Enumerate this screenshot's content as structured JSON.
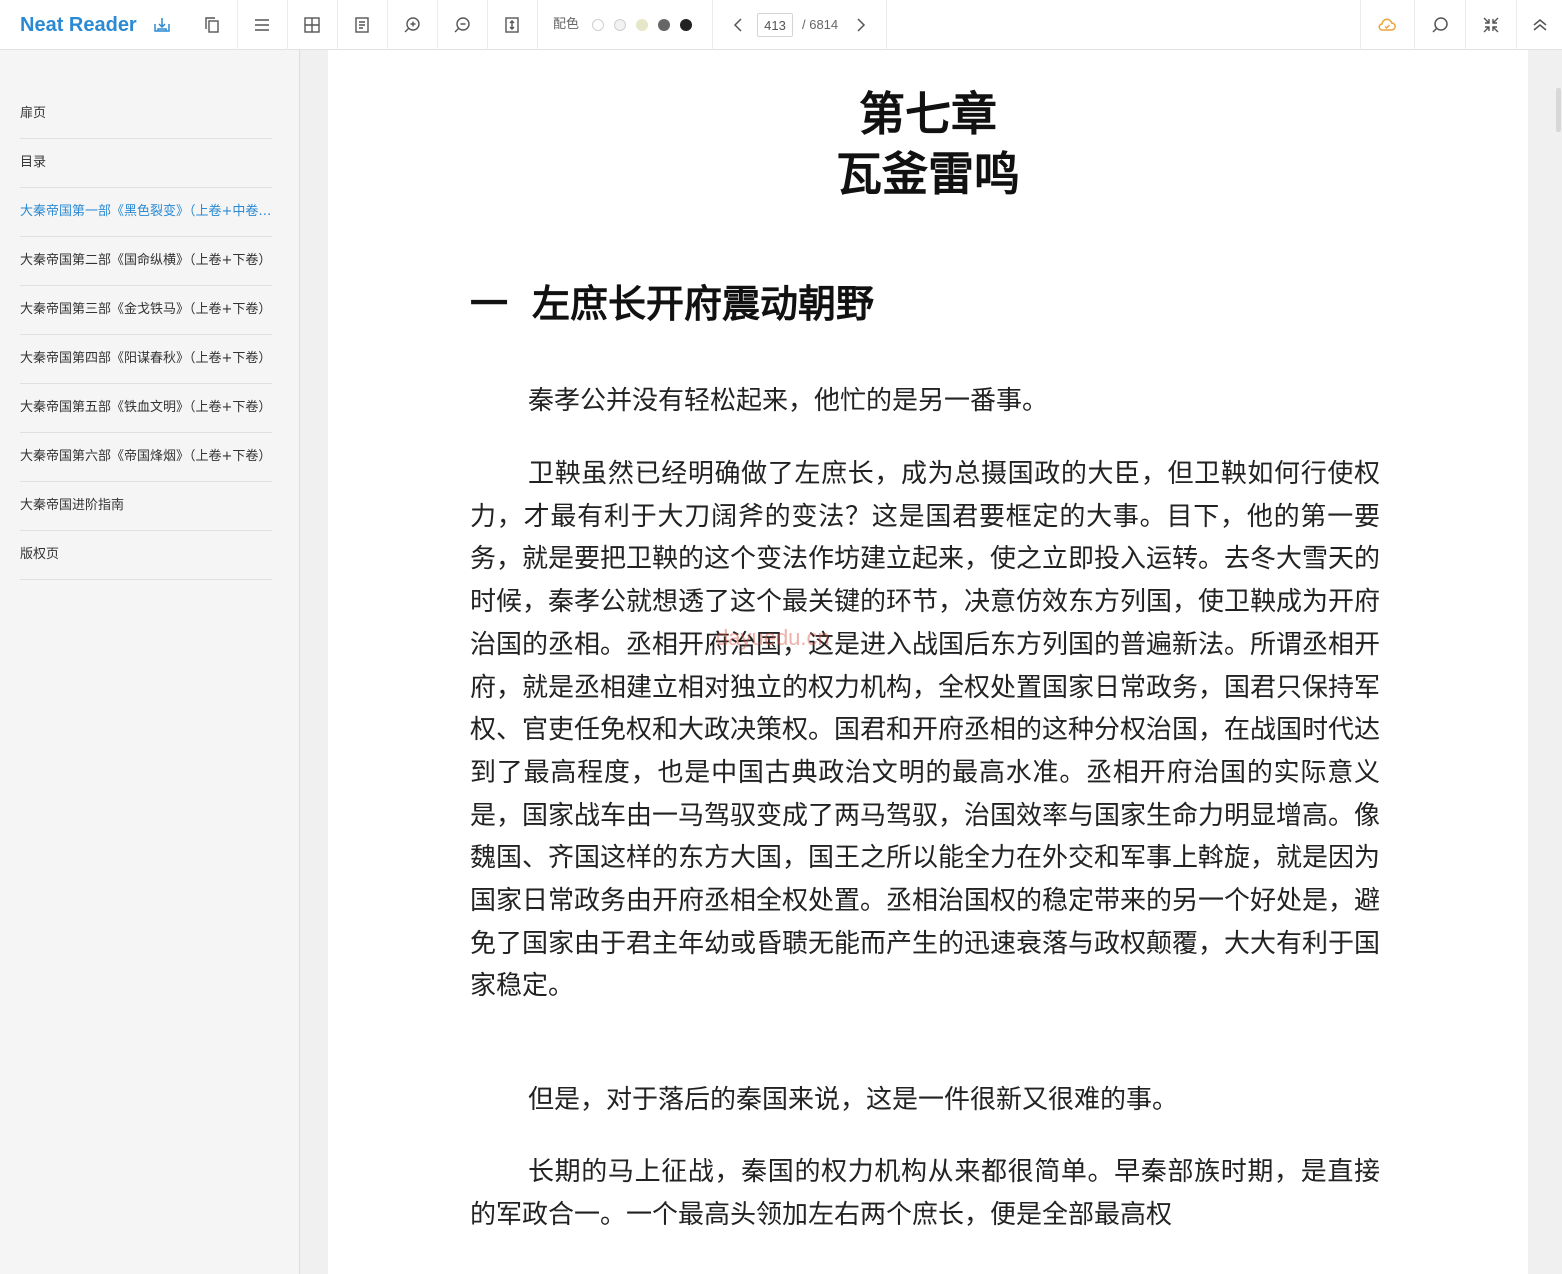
{
  "app": {
    "title": "Neat Reader"
  },
  "toolbar": {
    "theme_label": "配色",
    "theme_colors": [
      "#ffffff",
      "#f2f2f2",
      "#e6e6c8",
      "#666666",
      "#222222"
    ],
    "current_page": "413",
    "total_pages": "/ 6814"
  },
  "sidebar": {
    "items": [
      {
        "label": "扉页"
      },
      {
        "label": "目录"
      },
      {
        "label": "大秦帝国第一部《黑色裂变》（上卷+中卷+下卷）"
      },
      {
        "label": "大秦帝国第二部《国命纵横》（上卷+下卷）"
      },
      {
        "label": "大秦帝国第三部《金戈铁马》（上卷+下卷）"
      },
      {
        "label": "大秦帝国第四部《阳谋春秋》（上卷+下卷）"
      },
      {
        "label": "大秦帝国第五部《铁血文明》（上卷+下卷）"
      },
      {
        "label": "大秦帝国第六部《帝国烽烟》（上卷+下卷）"
      },
      {
        "label": "大秦帝国进阶指南"
      },
      {
        "label": "版权页"
      }
    ],
    "active_index": 2,
    "accent_color": "#2b8ad3"
  },
  "content": {
    "chapter_number": "第七章",
    "chapter_title": "瓦釜雷鸣",
    "section_number": "一",
    "section_title": "左庶长开府震动朝野",
    "paragraphs": [
      "秦孝公并没有轻松起来，他忙的是另一番事。",
      "卫鞅虽然已经明确做了左庶长，成为总摄国政的大臣，但卫鞅如何行使权力，才最有利于大刀阔斧的变法？这是国君要框定的大事。目下，他的第一要务，就是要把卫鞅的这个变法作坊建立起来，使之立即投入运转。去冬大雪天的时候，秦孝公就想透了这个最关键的环节，决意仿效东方列国，使卫鞅成为开府治国的丞相。丞相开府治国，这是进入战国后东方列国的普遍新法。所谓丞相开府，就是丞相建立相对独立的权力机构，全权处置国家日常政务，国君只保持军权、官吏任免权和大政决策权。国君和开府丞相的这种分权治国，在战国时代达到了最高程度，也是中国古典政治文明的最高水准。丞相开府治国的实际意义是，国家战车由一马驾驭变成了两马驾驭，治国效率与国家生命力明显增高。像魏国、齐国这样的东方大国，国王之所以能全力在外交和军事上斡旋，就是因为国家日常政务由开府丞相全权处置。丞相治国权的稳定带来的另一个好处是，避免了国家由于君主年幼或昏聩无能而产生的迅速衰落与政权颠覆，大大有利于国家稳定。",
      "但是，对于落后的秦国来说，这是一件很新又很难的事。",
      "长期的马上征战，秦国的权力机构从来都很简单。早秦部族时期，是直接的军政合一。一个最高头领加左右两个庶长，便是全部最高权"
    ],
    "watermark": "dayuedu.cn"
  }
}
